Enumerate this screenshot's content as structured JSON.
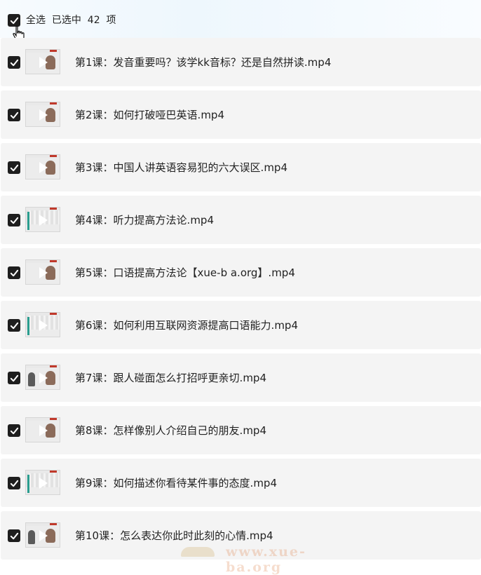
{
  "header": {
    "select_all_text": "全选  已选中  42  项",
    "checkbox_checked": true
  },
  "items": [
    {
      "title": "第1课：发音重要吗？该学kk音标？还是自然拼读.mp4",
      "thumb": "person"
    },
    {
      "title": "第2课：如何打破哑巴英语.mp4",
      "thumb": "person"
    },
    {
      "title": "第3课：中国人讲英语容易犯的六大误区.mp4",
      "thumb": "person"
    },
    {
      "title": "第4课：听力提高方法论.mp4",
      "thumb": "stripes"
    },
    {
      "title": "第5课：口语提高方法论【xue-b a.org】.mp4",
      "thumb": "person"
    },
    {
      "title": "第6课：如何利用互联网资源提高口语能力.mp4",
      "thumb": "stripes"
    },
    {
      "title": "第7课：跟人碰面怎么打招呼更亲切.mp4",
      "thumb": "two"
    },
    {
      "title": "第8课：怎样像别人介绍自己的朋友.mp4",
      "thumb": "person"
    },
    {
      "title": "第9课：如何描述你看待某件事的态度.mp4",
      "thumb": "stripes"
    },
    {
      "title": "第10课：怎么表达你此时此刻的心情.mp4",
      "thumb": "two"
    }
  ],
  "watermark": "www.xue-ba.org",
  "colors": {
    "checkbox": "#1e1e1e",
    "row_bg": "#f4f4f4"
  }
}
